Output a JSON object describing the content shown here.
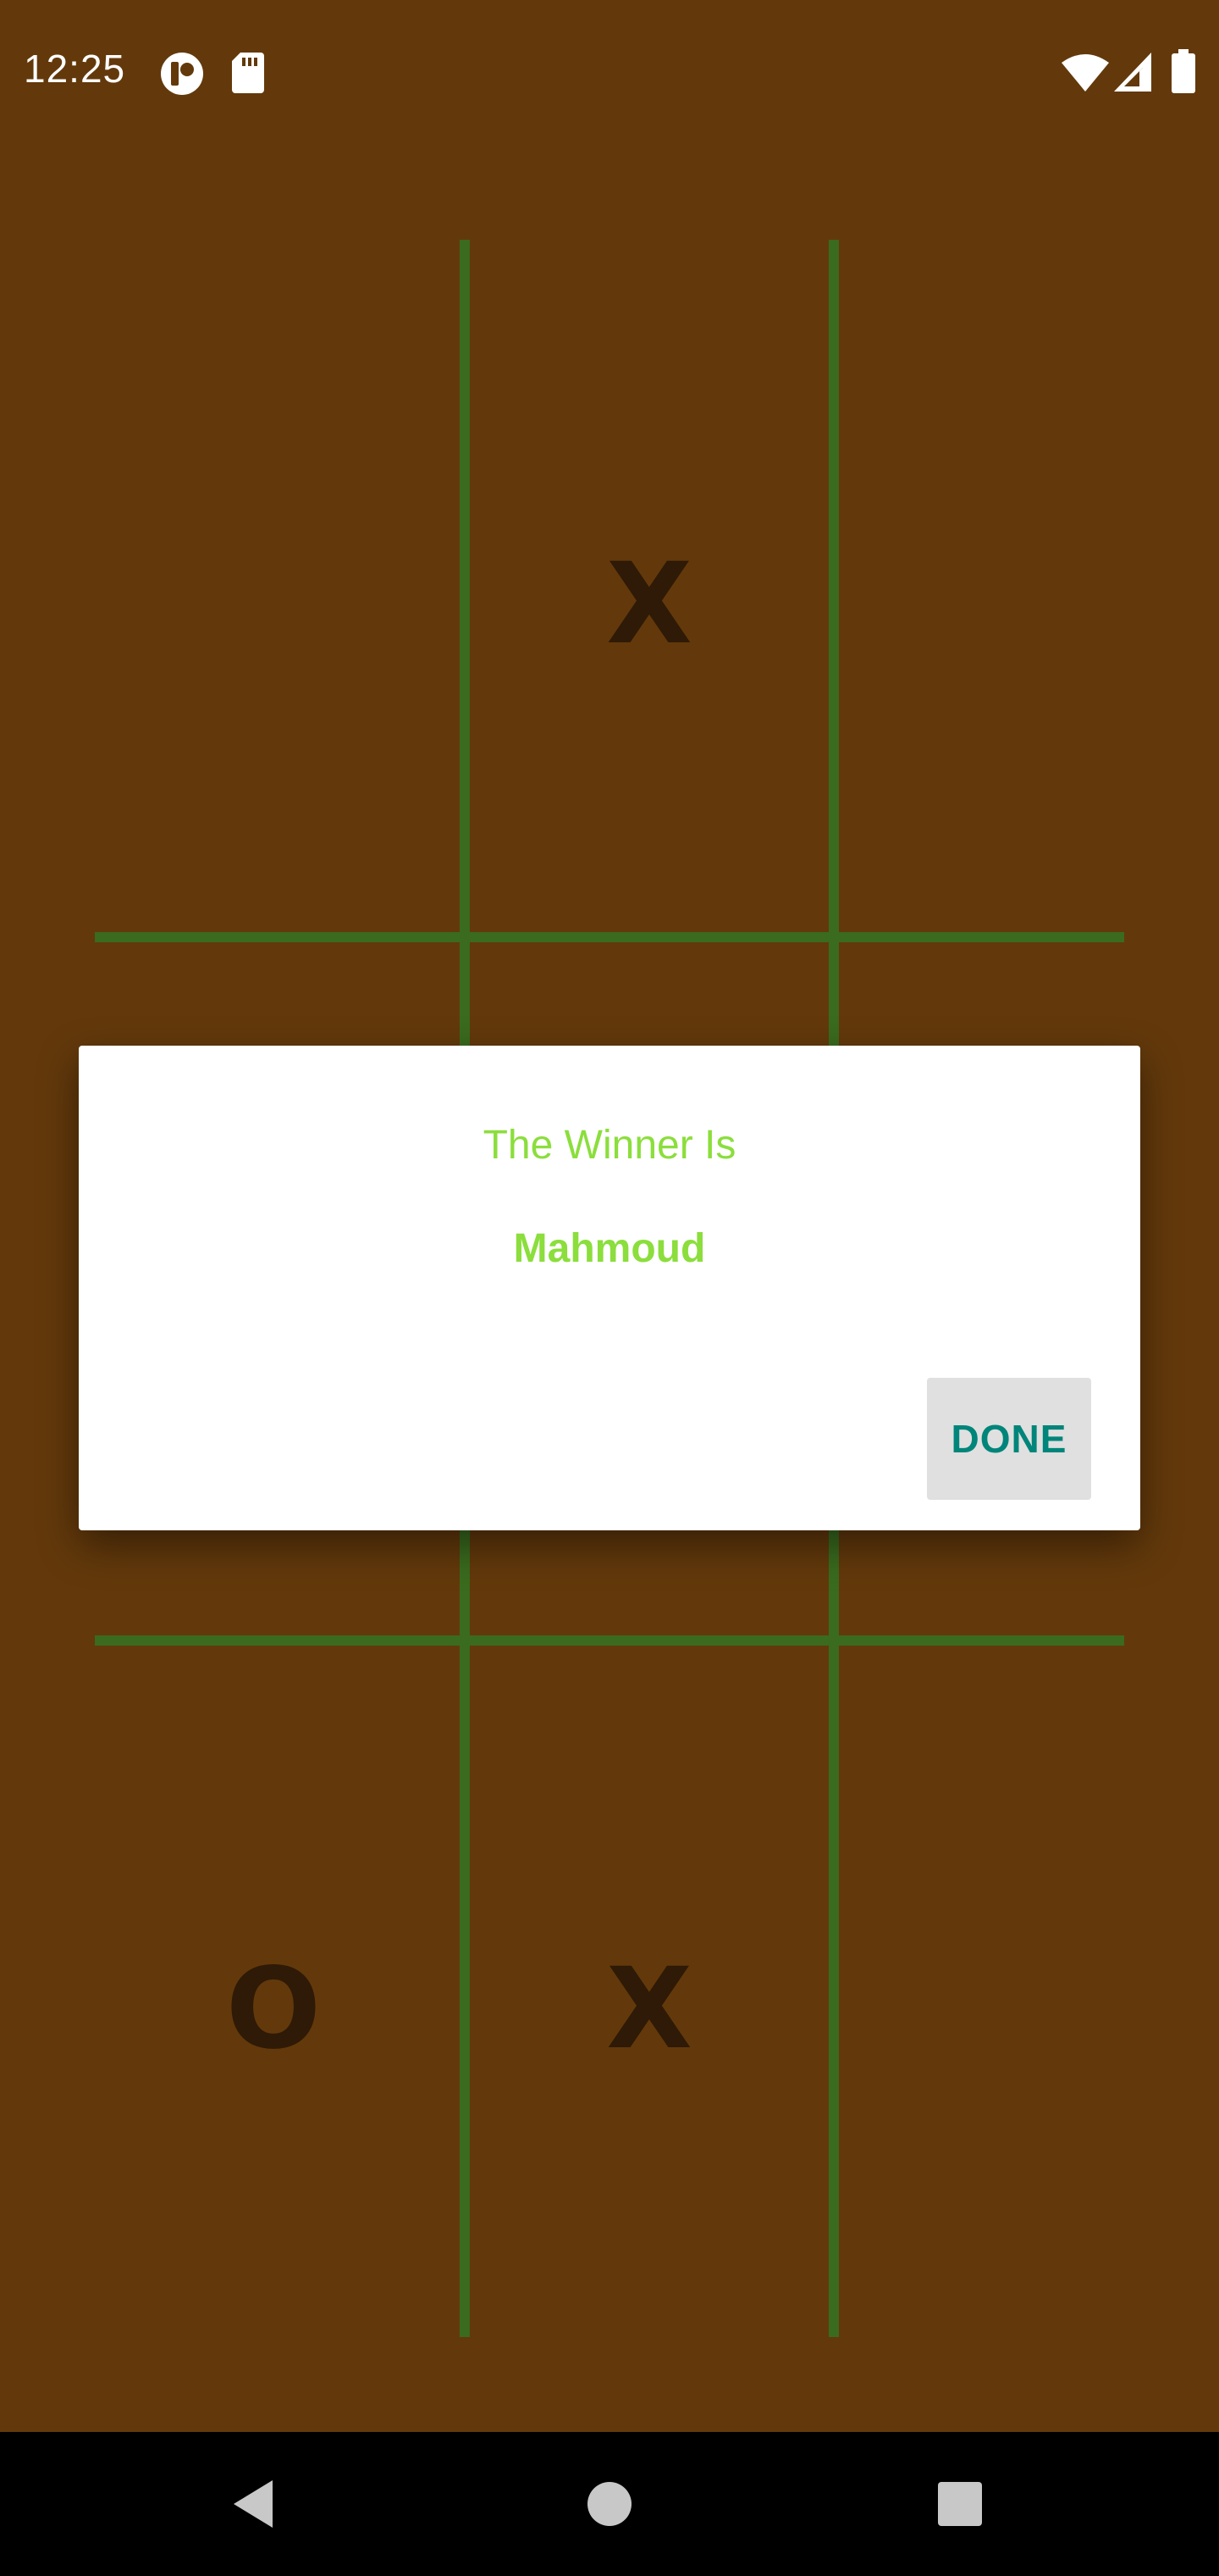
{
  "status_bar": {
    "time": "12:25",
    "icons_left": [
      "app-notification-icon",
      "sd-card-icon"
    ],
    "icons_right": [
      "wifi-icon",
      "cellular-signal-icon",
      "battery-icon"
    ]
  },
  "board": {
    "line_color": "#3a6b1e",
    "background": "#63390b",
    "cells": [
      {
        "label": ""
      },
      {
        "label": "X"
      },
      {
        "label": ""
      },
      {
        "label": ""
      },
      {
        "label": ""
      },
      {
        "label": ""
      },
      {
        "label": "O"
      },
      {
        "label": "X"
      },
      {
        "label": ""
      }
    ]
  },
  "dialog": {
    "title": "The Winner Is",
    "message": "Mahmoud",
    "done_label": "DONE",
    "accent_color": "#8bde3c",
    "button_text_color": "#00857a"
  },
  "nav_bar": {
    "buttons": [
      "back-icon",
      "home-icon",
      "recents-icon"
    ]
  }
}
